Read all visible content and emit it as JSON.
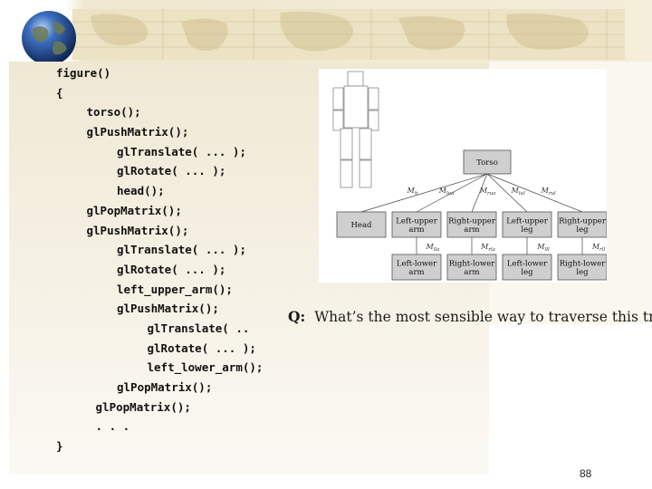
{
  "code_lines": [
    {
      "indent": 0,
      "text": "figure()"
    },
    {
      "indent": 0,
      "text": "{"
    },
    {
      "indent": 1,
      "text": "torso();"
    },
    {
      "indent": 1,
      "text": "glPushMatrix();"
    },
    {
      "indent": 2,
      "text": "glTranslate( ... );"
    },
    {
      "indent": 2,
      "text": "glRotate( ... );"
    },
    {
      "indent": 2,
      "text": "head();"
    },
    {
      "indent": 1,
      "text": "glPopMatrix();"
    },
    {
      "indent": 1,
      "text": "glPushMatrix();"
    },
    {
      "indent": 2,
      "text": "glTranslate( ... );"
    },
    {
      "indent": 2,
      "text": "glRotate( ... );"
    },
    {
      "indent": 2,
      "text": "left_upper_arm();"
    },
    {
      "indent": 2,
      "text": "glPushMatrix();"
    },
    {
      "indent": 3,
      "text": "glTranslate( .."
    },
    {
      "indent": 3,
      "text": "glRotate( ... );"
    },
    {
      "indent": 3,
      "text": "left_lower_arm();"
    },
    {
      "indent": 2,
      "text": "glPopMatrix();"
    },
    {
      "indent": 1.3,
      "text": "glPopMatrix();"
    },
    {
      "indent": 1.3,
      "text": ". . ."
    },
    {
      "indent": 0,
      "text": "}"
    }
  ],
  "tree": {
    "root": "Torso",
    "children": [
      {
        "label": [
          "Head"
        ],
        "edge": "M",
        "edge_sub": "h",
        "child": null
      },
      {
        "label": [
          "Left-upper",
          "arm"
        ],
        "edge": "M",
        "edge_sub": "lua",
        "child": {
          "label": [
            "Left-lower",
            "arm"
          ],
          "edge": "M",
          "edge_sub": "lla"
        }
      },
      {
        "label": [
          "Right-upper",
          "arm"
        ],
        "edge": "M",
        "edge_sub": "rua",
        "child": {
          "label": [
            "Right-lower",
            "arm"
          ],
          "edge": "M",
          "edge_sub": "rla"
        }
      },
      {
        "label": [
          "Left-upper",
          "leg"
        ],
        "edge": "M",
        "edge_sub": "lul",
        "child": {
          "label": [
            "Left-lower",
            "leg"
          ],
          "edge": "M",
          "edge_sub": "lll"
        }
      },
      {
        "label": [
          "Right-upper",
          "leg"
        ],
        "edge": "M",
        "edge_sub": "rul",
        "child": {
          "label": [
            "Right-lower",
            "leg"
          ],
          "edge": "M",
          "edge_sub": "rll"
        }
      }
    ]
  },
  "question": {
    "label": "Q:",
    "text": "What’s the most sensible way to traverse this tree?"
  },
  "page_number": "88",
  "colors": {
    "node_fill": "#cfcfcf",
    "node_stroke": "#555555",
    "edge": "#444444"
  }
}
